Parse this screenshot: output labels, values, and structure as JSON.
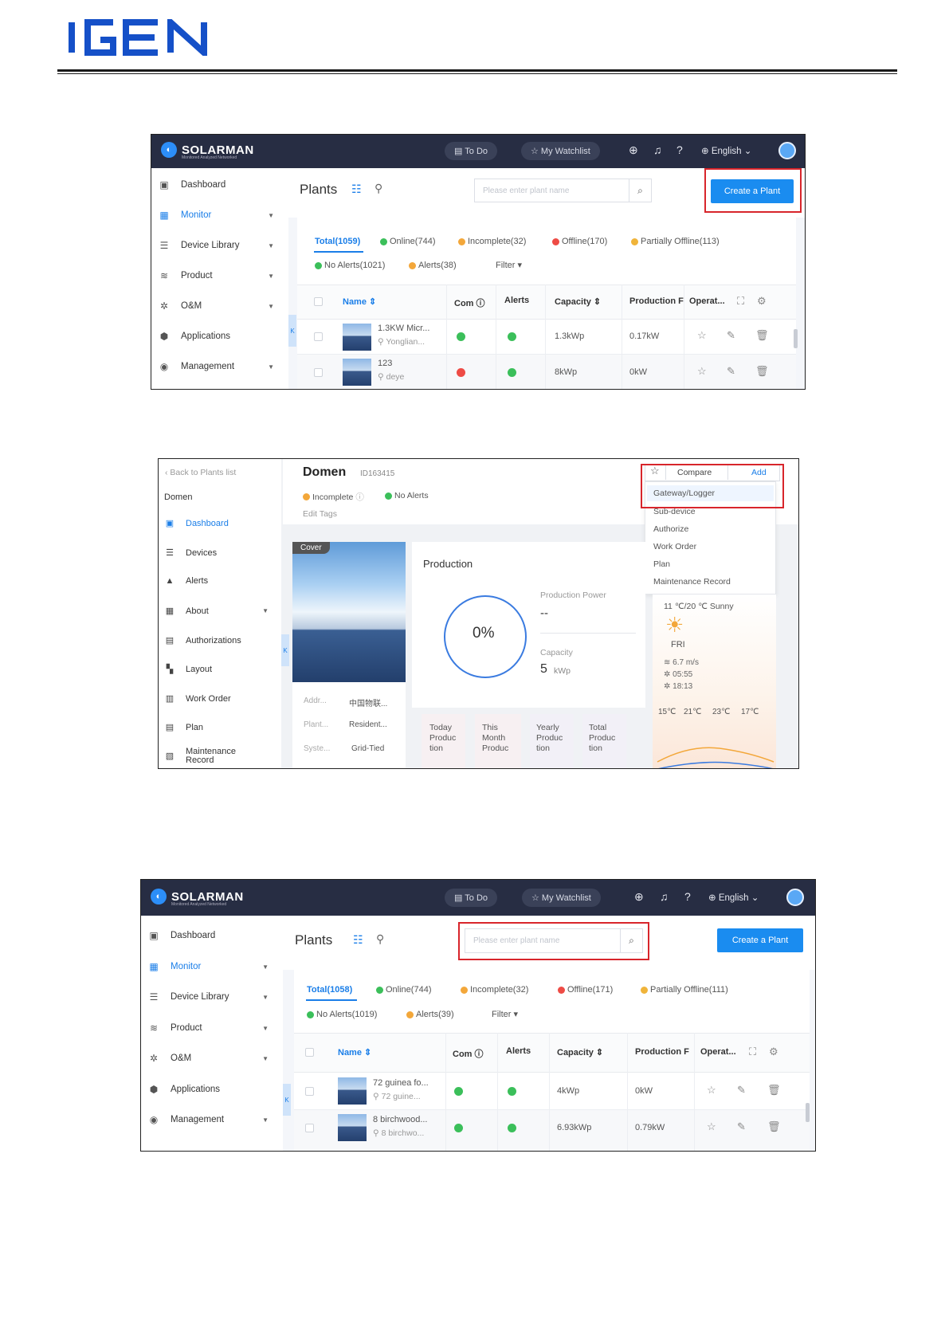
{
  "brand": {
    "logo_text": "IGEN"
  },
  "shot1": {
    "topbar": {
      "app_name": "SOLARMAN",
      "app_tagline": "Monitored Analyzed Networked",
      "todo": "To Do",
      "watchlist": "My Watchlist",
      "language": "English"
    },
    "sidebar": [
      {
        "label": "Dashboard",
        "icon": "dashboard-icon"
      },
      {
        "label": "Monitor",
        "icon": "monitor-icon",
        "active": true,
        "caret": true
      },
      {
        "label": "Device Library",
        "icon": "device-library-icon",
        "caret": true
      },
      {
        "label": "Product",
        "icon": "product-icon",
        "caret": true
      },
      {
        "label": "O&M",
        "icon": "om-icon",
        "caret": true
      },
      {
        "label": "Applications",
        "icon": "applications-icon"
      },
      {
        "label": "Management",
        "icon": "management-icon",
        "caret": true
      }
    ],
    "title": "Plants",
    "search_placeholder": "Please enter plant name",
    "create_button": "Create a Plant",
    "stats": {
      "total": "Total(1059)",
      "online": "Online(744)",
      "incomplete": "Incomplete(32)",
      "offline": "Offline(170)",
      "partial": "Partially Offline(113)",
      "no_alerts": "No Alerts(1021)",
      "alerts": "Alerts(38)",
      "filter": "Filter"
    },
    "columns": {
      "name": "Name",
      "com": "Com",
      "alerts": "Alerts",
      "capacity": "Capacity",
      "production": "Production F",
      "operation": "Operat..."
    },
    "rows": [
      {
        "name": "1.3KW Micr...",
        "location": "Yonglian...",
        "com": "green",
        "alerts": "green",
        "capacity": "1.3kWp",
        "production": "0.17kW"
      },
      {
        "name": "123",
        "location": "deye",
        "com": "red",
        "alerts": "green",
        "capacity": "8kWp",
        "production": "0kW"
      }
    ]
  },
  "shot2": {
    "back": "Back to Plants list",
    "plant_label": "Domen",
    "sidebar": [
      {
        "label": "Dashboard",
        "icon": "dashboard-icon",
        "active": true
      },
      {
        "label": "Devices",
        "icon": "devices-icon"
      },
      {
        "label": "Alerts",
        "icon": "alerts-icon"
      },
      {
        "label": "About",
        "icon": "about-icon",
        "caret": true
      },
      {
        "label": "Authorizations",
        "icon": "authorizations-icon"
      },
      {
        "label": "Layout",
        "icon": "layout-icon"
      },
      {
        "label": "Work Order",
        "icon": "work-order-icon"
      },
      {
        "label": "Plan",
        "icon": "plan-icon"
      },
      {
        "label": "Maintenance",
        "label2": "Record",
        "icon": "maintenance-icon"
      }
    ],
    "plant_name": "Domen",
    "plant_id": "ID163415",
    "status_incomplete": "Incomplete",
    "status_alerts": "No Alerts",
    "edit_tags": "Edit Tags",
    "compare": "Compare",
    "add": "Add",
    "menu": [
      "Gateway/Logger",
      "Sub-device",
      "Authorize",
      "Work Order",
      "Plan",
      "Maintenance Record"
    ],
    "cover_label": "Cover",
    "info": [
      {
        "k": "Addr...",
        "v": "中国物联..."
      },
      {
        "k": "Plant...",
        "v": "Resident..."
      },
      {
        "k": "Syste...",
        "v": "Grid-Tied"
      }
    ],
    "production": {
      "title": "Production",
      "percent": "0%",
      "power_label": "Production Power",
      "power_value": "--",
      "capacity_label": "Capacity",
      "capacity_value": "5",
      "capacity_unit": "kWp"
    },
    "tiles": [
      {
        "l1": "Today",
        "l2": "Produc",
        "l3": "tion"
      },
      {
        "l1": "This",
        "l2": "Month",
        "l3": "Produc"
      },
      {
        "l1": "Yearly",
        "l2": "Produc",
        "l3": "tion"
      },
      {
        "l1": "Total",
        "l2": "Produc",
        "l3": "tion"
      }
    ],
    "weather": {
      "summary": "11 ℃/20 ℃ Sunny",
      "day": "FRI",
      "wind": "6.7 m/s",
      "sunrise": "05:55",
      "sunset": "18:13",
      "temps": [
        "15℃",
        "21℃",
        "23℃",
        "17℃"
      ]
    }
  },
  "shot3": {
    "topbar": {
      "app_name": "SOLARMAN",
      "app_tagline": "Monitored Analyzed Networked",
      "todo": "To Do",
      "watchlist": "My Watchlist",
      "language": "English"
    },
    "title": "Plants",
    "search_placeholder": "Please enter plant name",
    "create_button": "Create a Plant",
    "stats": {
      "total": "Total(1058)",
      "online": "Online(744)",
      "incomplete": "Incomplete(32)",
      "offline": "Offline(171)",
      "partial": "Partially Offline(111)",
      "no_alerts": "No Alerts(1019)",
      "alerts": "Alerts(39)",
      "filter": "Filter"
    },
    "rows": [
      {
        "name": "72 guinea fo...",
        "location": "72 guine...",
        "com": "green",
        "alerts": "green",
        "capacity": "4kWp",
        "production": "0kW"
      },
      {
        "name": "8 birchwood...",
        "location": "8 birchwo...",
        "com": "green",
        "alerts": "green",
        "capacity": "6.93kWp",
        "production": "0.79kW"
      }
    ]
  }
}
